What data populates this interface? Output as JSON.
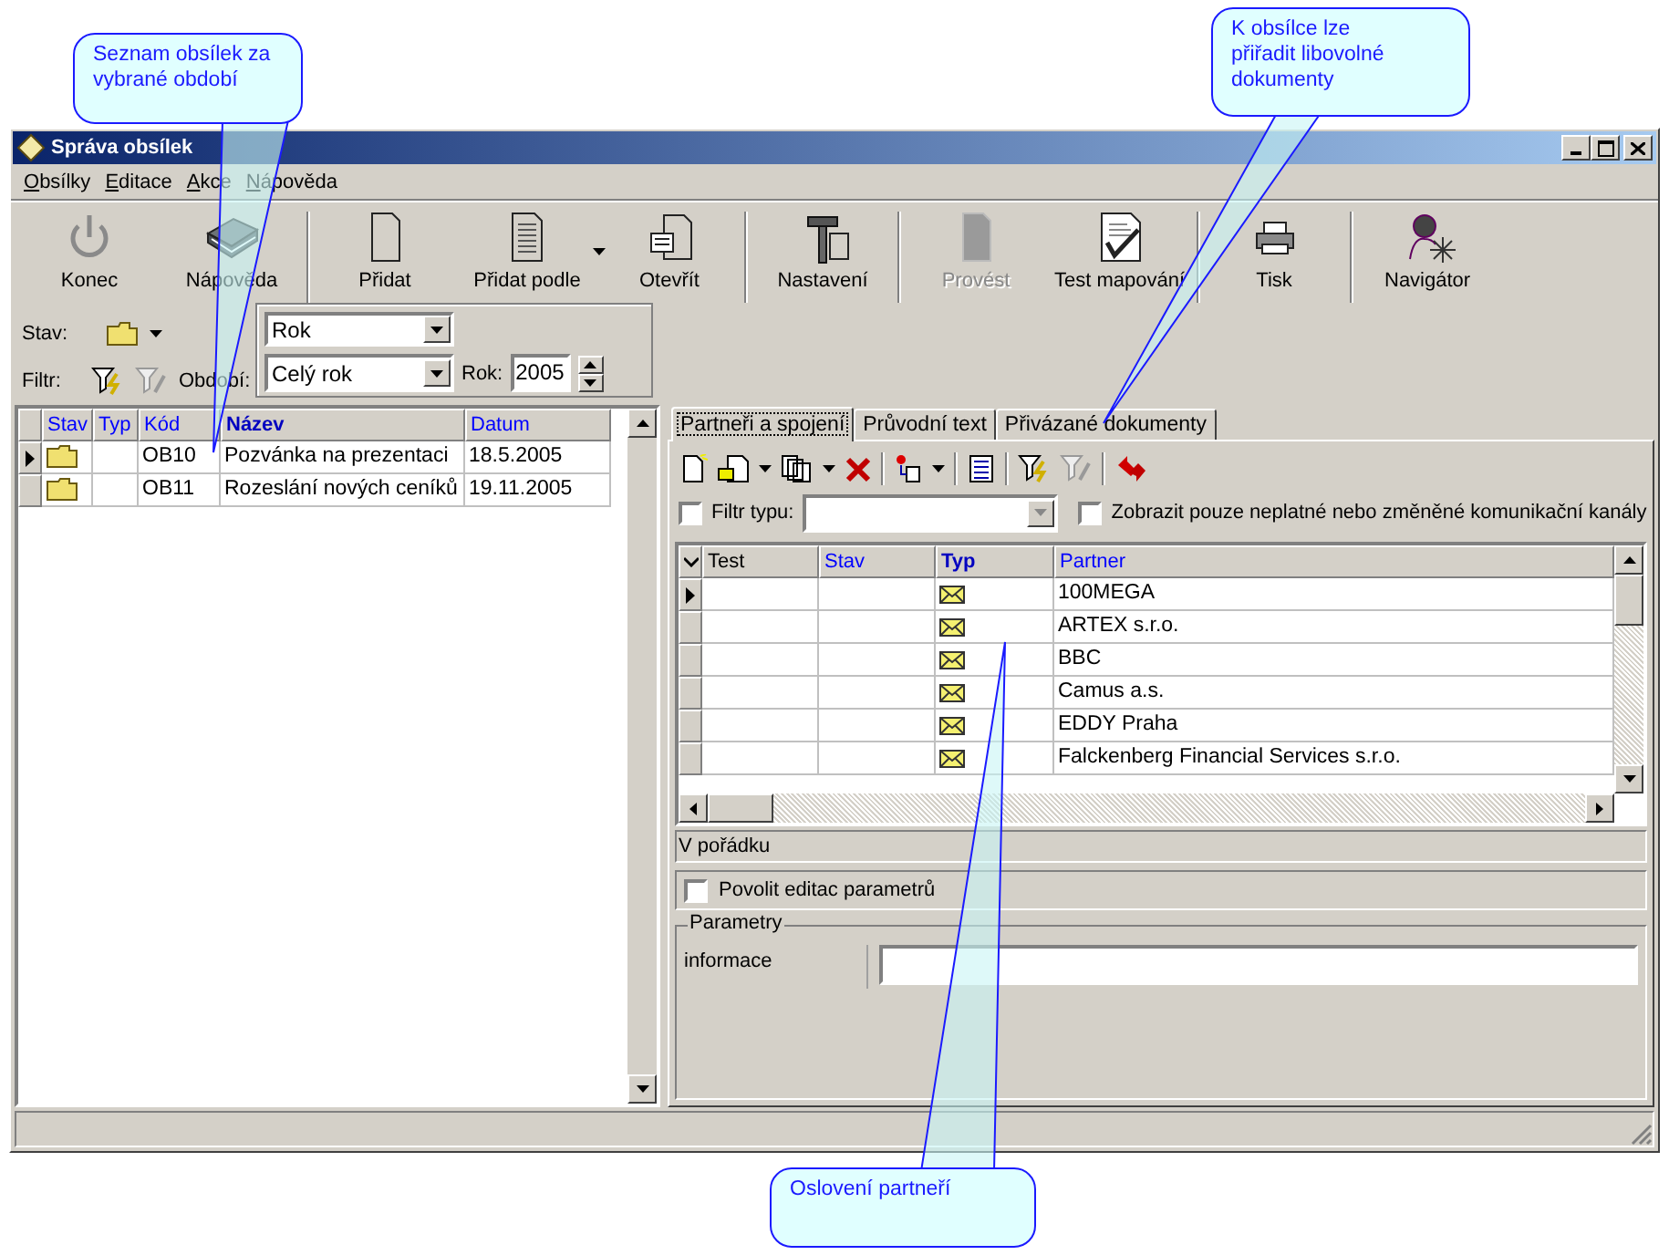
{
  "callouts": [
    {
      "text": "Seznam obsílek za vybrané období"
    },
    {
      "text": "K obsílce lze přiřadit libovolné dokumenty"
    },
    {
      "text": "Oslovení partneří"
    }
  ],
  "window": {
    "title": "Správa obsílek"
  },
  "menu": [
    {
      "label": "Obsílky"
    },
    {
      "label": "Editace"
    },
    {
      "label": "Akce"
    },
    {
      "label": "Nápověda"
    }
  ],
  "toolbar": [
    {
      "items": [
        {
          "label": "Konec",
          "disabled": false
        },
        {
          "label": "Nápověda",
          "disabled": false
        }
      ]
    },
    {
      "items": [
        {
          "label": "Přidat",
          "disabled": false
        },
        {
          "label": "Přidat podle",
          "disabled": false,
          "dropdown": true
        },
        {
          "label": "Otevřít",
          "disabled": false
        }
      ]
    },
    {
      "items": [
        {
          "label": "Nastavení",
          "disabled": false
        }
      ]
    },
    {
      "items": [
        {
          "label": "Provést",
          "disabled": true
        },
        {
          "label": "Test mapování",
          "disabled": false
        }
      ]
    },
    {
      "items": [
        {
          "label": "Tisk",
          "disabled": false
        }
      ]
    },
    {
      "items": [
        {
          "label": "Navigátor",
          "disabled": false
        }
      ]
    }
  ],
  "filters": {
    "stav_label": "Stav:",
    "filtr_label": "Filtr:",
    "period_label": "Období:",
    "period_type": "Rok",
    "period": "Celý rok",
    "year_label": "Rok:",
    "year": "2005"
  },
  "list": {
    "columns": [
      {
        "label": "Stav",
        "sorted": false
      },
      {
        "label": "Typ",
        "sorted": false
      },
      {
        "label": "Kód",
        "sorted": false
      },
      {
        "label": "Název",
        "sorted": true
      },
      {
        "label": "Datum",
        "sorted": false
      }
    ],
    "rows": [
      {
        "selected": true,
        "code": "OB10",
        "name": "Pozvánka na prezentaci",
        "date": "18.5.2005"
      },
      {
        "selected": false,
        "code": "OB11",
        "name": "Rozeslání nových ceníků",
        "date": "19.11.2005"
      }
    ]
  },
  "tabs": [
    {
      "label": "Partneři a spojení",
      "selected": true
    },
    {
      "label": "Průvodní text",
      "selected": false
    },
    {
      "label": "Přivázané dokumenty",
      "selected": false
    }
  ],
  "type_filter": {
    "label": "Filtr typu:",
    "checked": false
  },
  "invalid_only": {
    "label": "Zobrazit pouze neplatné nebo změněné komunikační kanály",
    "checked": false
  },
  "partners": {
    "columns": [
      {
        "label": "Test",
        "sortable": false,
        "sorted": false
      },
      {
        "label": "Stav",
        "sortable": true,
        "sorted": false
      },
      {
        "label": "Typ",
        "sortable": true,
        "sorted": true
      },
      {
        "label": "Partner",
        "sortable": true,
        "sorted": false
      }
    ],
    "rows": [
      {
        "selected": true,
        "partner": "100MEGA"
      },
      {
        "selected": false,
        "partner": "ARTEX s.r.o."
      },
      {
        "selected": false,
        "partner": "BBC"
      },
      {
        "selected": false,
        "partner": "Camus a.s."
      },
      {
        "selected": false,
        "partner": "EDDY Praha"
      },
      {
        "selected": false,
        "partner": "Falckenberg Financial Services s.r.o."
      }
    ]
  },
  "check_status": "V pořádku",
  "allow_edit": {
    "label": "Povolit editac parametrů",
    "checked": false
  },
  "parameters": {
    "title": "Parametry",
    "rows": [
      {
        "label": "informace"
      }
    ]
  }
}
